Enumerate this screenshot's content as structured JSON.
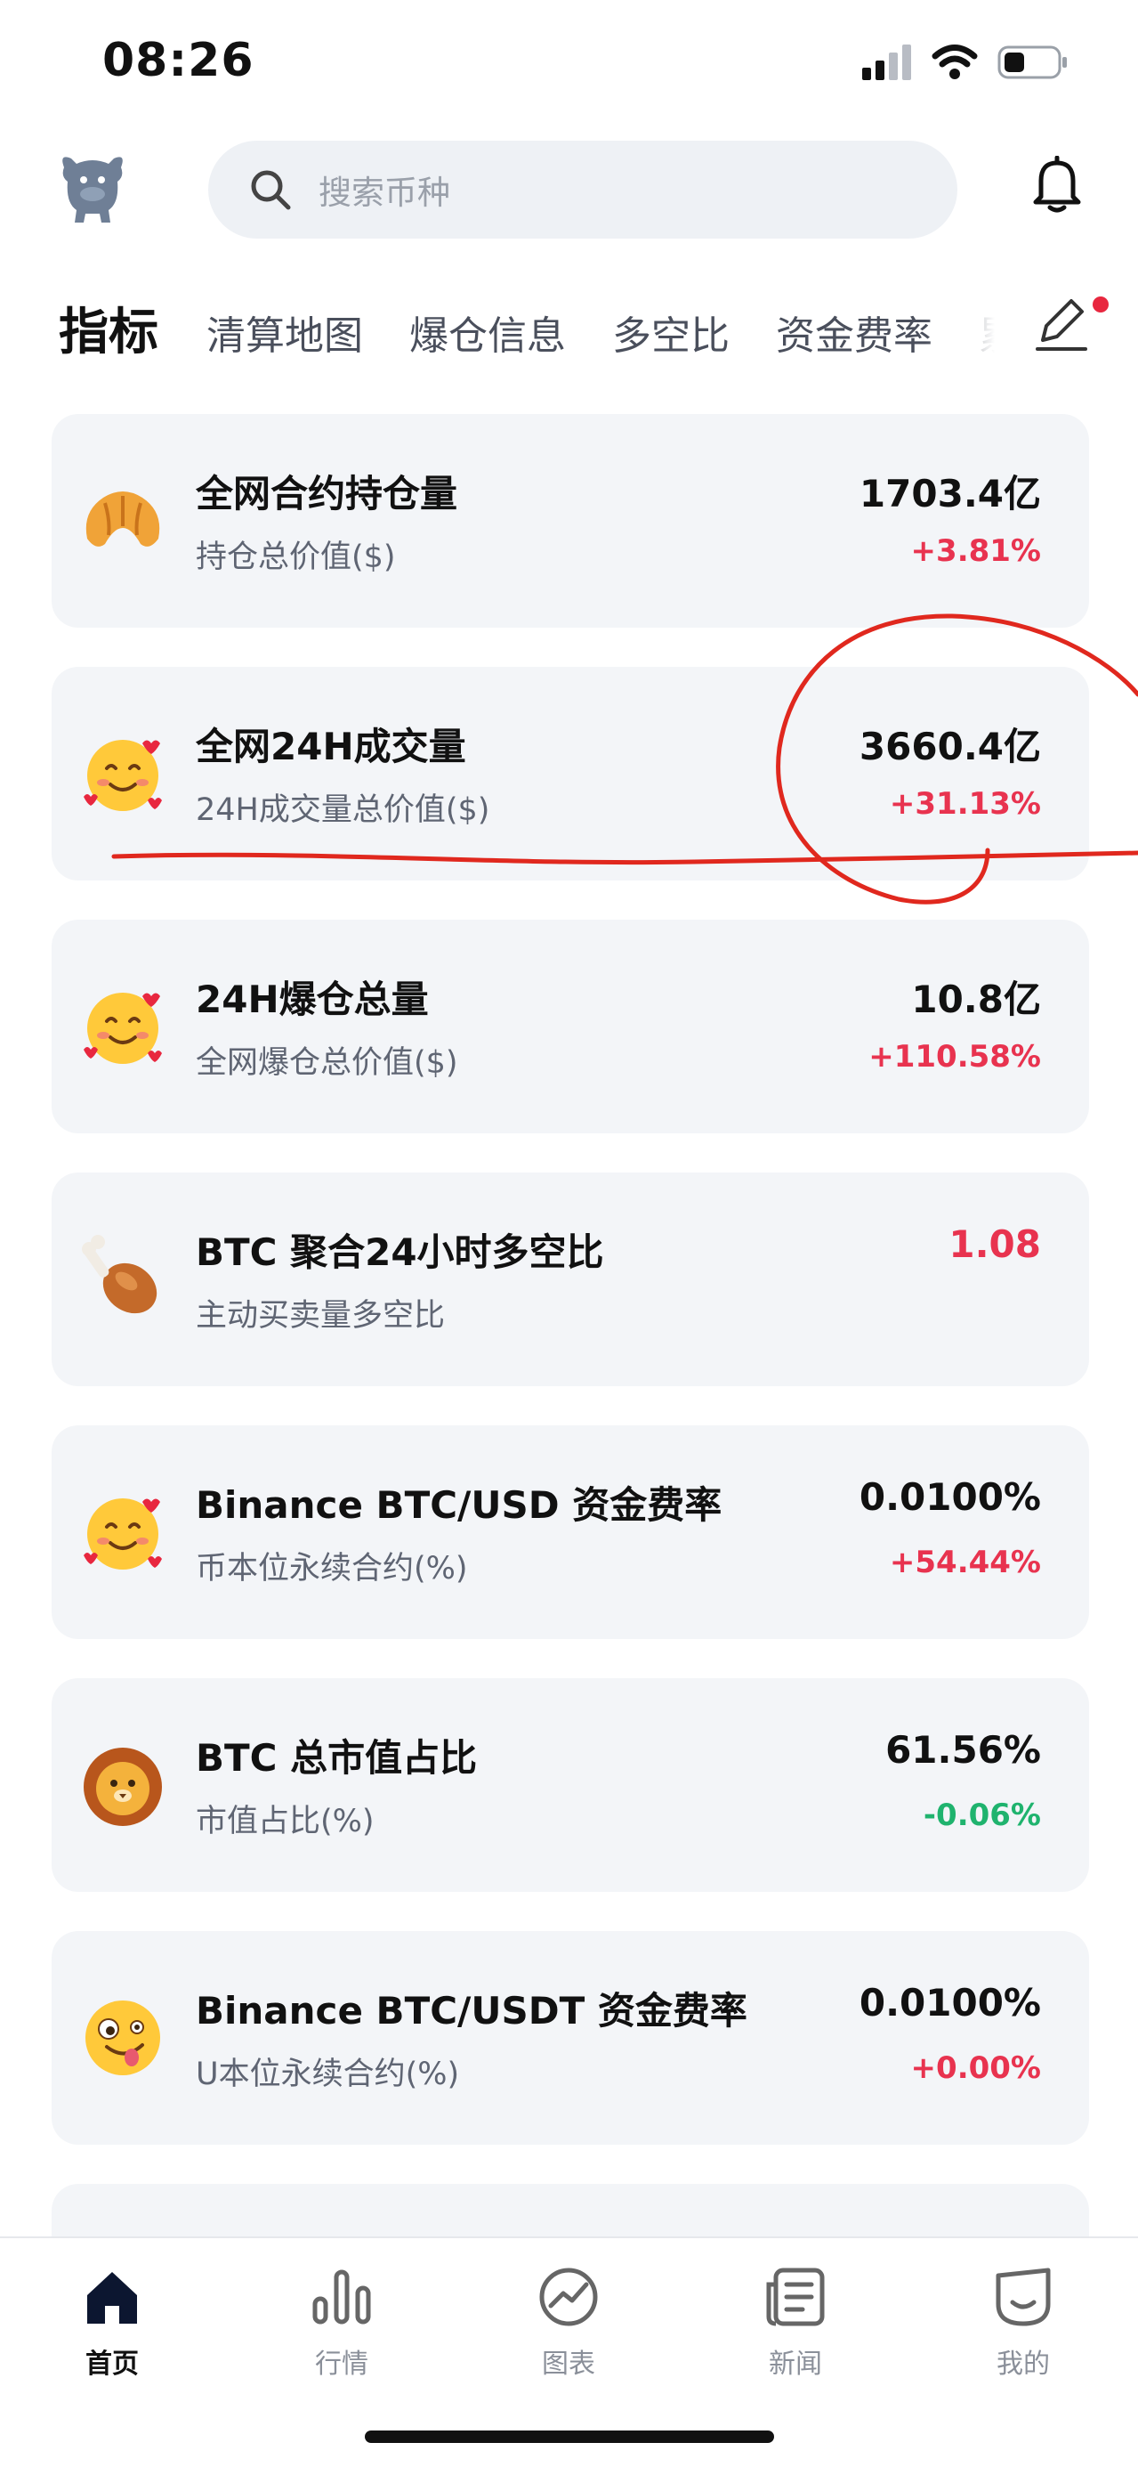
{
  "status_bar": {
    "time": "08:26"
  },
  "header": {
    "search_placeholder": "搜索币种",
    "logo_icon": "bull-mascot-icon",
    "bell_icon": "bell-icon"
  },
  "tabs": {
    "items": [
      {
        "label": "指标",
        "active": true
      },
      {
        "label": "清算地图"
      },
      {
        "label": "爆仓信息"
      },
      {
        "label": "多空比"
      },
      {
        "label": "资金费率"
      },
      {
        "label": "累计"
      }
    ],
    "edit_icon": "pencil-icon"
  },
  "cards": [
    {
      "emoji": "🥐",
      "title": "全网合约持仓量",
      "subtitle": "持仓总价值($)",
      "value": "1703.4亿",
      "change": "+3.81%"
    },
    {
      "emoji": "🥰",
      "title": "全网24H成交量",
      "subtitle": "24H成交量总价值($)",
      "value": "3660.4亿",
      "change": "+31.13%"
    },
    {
      "emoji": "🥰",
      "title": "24H爆仓总量",
      "subtitle": "全网爆仓总价值($)",
      "value": "10.8亿",
      "change": "+110.58%"
    },
    {
      "emoji": "🍗",
      "title": "BTC 聚合24小时多空比",
      "subtitle": "主动买卖量多空比",
      "value": "1.08",
      "change": ""
    },
    {
      "emoji": "🥰",
      "title": "Binance BTC/USD 资金费率",
      "subtitle": "币本位永续合约(%)",
      "value": "0.0100%",
      "change": "+54.44%"
    },
    {
      "emoji": "🦁",
      "title": "BTC 总市值占比",
      "subtitle": "市值占比(%)",
      "value": "61.56%",
      "change": "-0.06%"
    },
    {
      "emoji": "🤪",
      "title": "Binance BTC/USDT 资金费率",
      "subtitle": "U本位永续合约(%)",
      "value": "0.0100%",
      "change": "+0.00%"
    }
  ],
  "bottom_nav": [
    {
      "label": "首页",
      "icon": "home-icon",
      "active": true
    },
    {
      "label": "行情",
      "icon": "bar-chart-icon"
    },
    {
      "label": "图表",
      "icon": "trend-chart-icon"
    },
    {
      "label": "新闻",
      "icon": "news-icon"
    },
    {
      "label": "我的",
      "icon": "profile-icon"
    }
  ],
  "colors": {
    "up": "#e8334f",
    "down": "#1fb36e",
    "card_bg": "#f3f5f8",
    "annotation": "#e0281e"
  }
}
